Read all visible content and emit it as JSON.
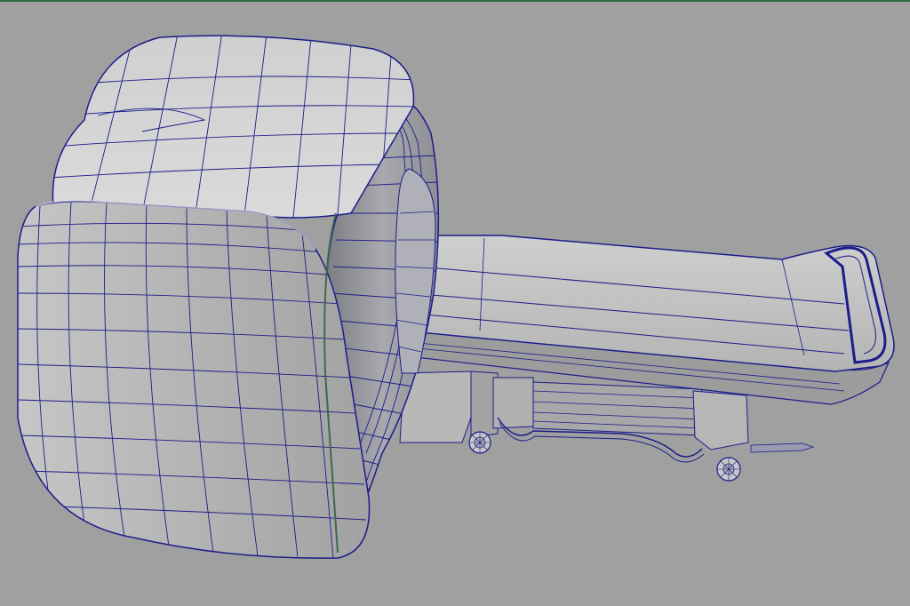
{
  "viewport": {
    "background": "#a0a0a0",
    "top_line_color": "#2f6b3f",
    "wire_color": "#1c1c8a",
    "subject": "mri-scanner-with-patient-table",
    "display_mode": "wireframe-on-shaded",
    "shading": {
      "light": "#d2d2d2",
      "mid": "#b6b6b6",
      "dark": "#8a8a8a",
      "edge": "#5a5a6e"
    }
  }
}
